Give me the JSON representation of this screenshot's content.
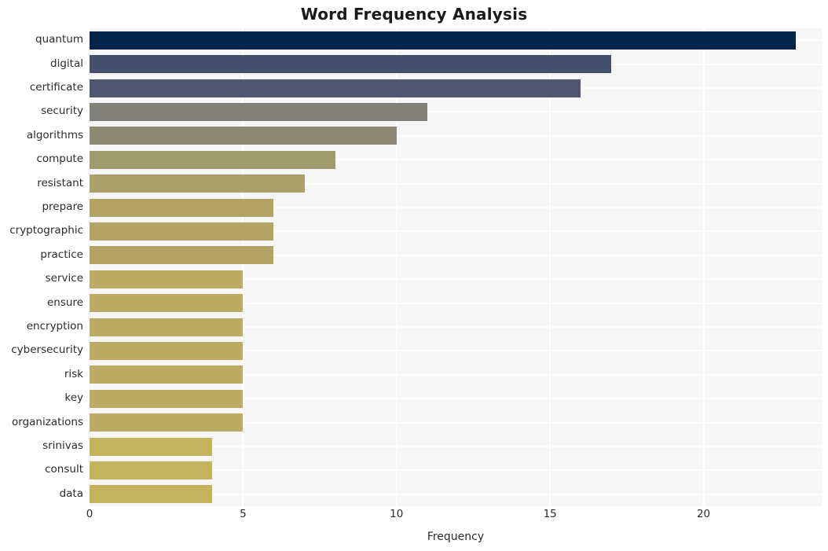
{
  "chart_data": {
    "type": "bar",
    "orientation": "horizontal",
    "title": "Word Frequency Analysis",
    "xlabel": "Frequency",
    "ylabel": "",
    "xlim": [
      0,
      23.85
    ],
    "xticks": [
      0,
      5,
      10,
      15,
      20
    ],
    "xtick_labels": [
      "0",
      "5",
      "10",
      "15",
      "20"
    ],
    "grid": true,
    "grid_axis": "both",
    "grid_color": "#ffffff",
    "plot_background": "#f6f6f7",
    "figure_background": "#ffffff",
    "legend": null,
    "categories": [
      "quantum",
      "digital",
      "certificate",
      "security",
      "algorithms",
      "compute",
      "resistant",
      "prepare",
      "cryptographic",
      "practice",
      "service",
      "ensure",
      "encryption",
      "cybersecurity",
      "risk",
      "key",
      "organizations",
      "srinivas",
      "consult",
      "data"
    ],
    "values": [
      23,
      17,
      16,
      11,
      10,
      8,
      7,
      6,
      6,
      6,
      5,
      5,
      5,
      5,
      5,
      5,
      5,
      4,
      4,
      4
    ],
    "bar_colors": [
      "#042449",
      "#454f6e",
      "#515572",
      "#82807b",
      "#8c8a73",
      "#a09a6f",
      "#ab9f6a",
      "#b3a466",
      "#b3a466",
      "#b3a466",
      "#bcab62",
      "#bcab62",
      "#bcab62",
      "#bcab62",
      "#bcab62",
      "#bcab62",
      "#bcab62",
      "#c4b25d",
      "#c4b25d",
      "#c4b25d"
    ]
  },
  "colors": {
    "title_text": "#1a1a1a",
    "tick_text": "#2b2b2b",
    "axis_label_text": "#2b2b2b"
  }
}
